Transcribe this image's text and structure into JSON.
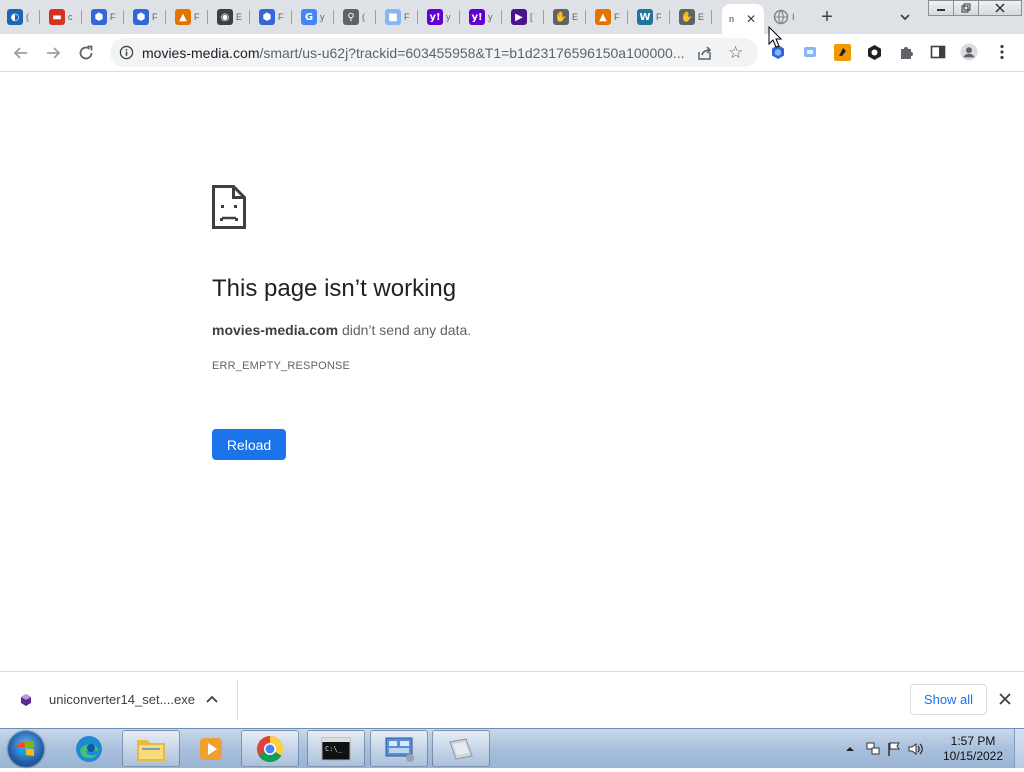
{
  "browser": {
    "tabs": [
      {
        "icon": "circle-logo-icon",
        "title": "(",
        "color": "#1a66b8"
      },
      {
        "icon": "red-dash-icon",
        "title": "c",
        "color": "#d93025"
      },
      {
        "icon": "cube-icon",
        "title": "F",
        "color": "#3367d6"
      },
      {
        "icon": "cube-icon",
        "title": "F",
        "color": "#3367d6"
      },
      {
        "icon": "colored-hat-icon",
        "title": "F",
        "color": "#e37400"
      },
      {
        "icon": "globe-dark-icon",
        "title": "E",
        "color": "#3c4043"
      },
      {
        "icon": "cube-icon",
        "title": "F",
        "color": "#3367d6"
      },
      {
        "icon": "google-icon",
        "title": "y",
        "color": "#4285f4"
      },
      {
        "icon": "search-icon",
        "title": "(",
        "color": "#5f6368"
      },
      {
        "icon": "cloud-icon",
        "title": "F",
        "color": "#8ab4f8"
      },
      {
        "icon": "yahoo-icon",
        "title": "y",
        "color": "#6001d2"
      },
      {
        "icon": "yahoo-icon",
        "title": "y",
        "color": "#6001d2"
      },
      {
        "icon": "purple-app-icon",
        "title": "[",
        "color": "#4a148c"
      },
      {
        "icon": "hand-icon",
        "title": "E",
        "color": "#5f6368"
      },
      {
        "icon": "colored-hat-icon",
        "title": "F",
        "color": "#e37400"
      },
      {
        "icon": "wordpress-icon",
        "title": "F",
        "color": "#21759b"
      },
      {
        "icon": "hand-icon",
        "title": "E",
        "color": "#5f6368"
      }
    ],
    "active_tab": {
      "title": "n",
      "close_glyph": "✕"
    },
    "loading_tab": {
      "icon": "globe-icon",
      "title": "I"
    },
    "new_tab_glyph": "+",
    "url": {
      "host": "movies-media.com",
      "rest": "/smart/us-u62j?trackid=603455958&T1=b1d23176596150a100000..."
    }
  },
  "error_page": {
    "title": "This page isn’t working",
    "host": "movies-media.com",
    "message": " didn’t send any data.",
    "code": "ERR_EMPTY_RESPONSE",
    "reload_label": "Reload"
  },
  "download_shelf": {
    "filename": "uniconverter14_set....exe",
    "show_all_label": "Show all"
  },
  "taskbar": {
    "time": "1:57 PM",
    "date": "10/15/2022"
  },
  "colors": {
    "accent": "#1a73e8",
    "tabstrip": "#dee1e6"
  }
}
